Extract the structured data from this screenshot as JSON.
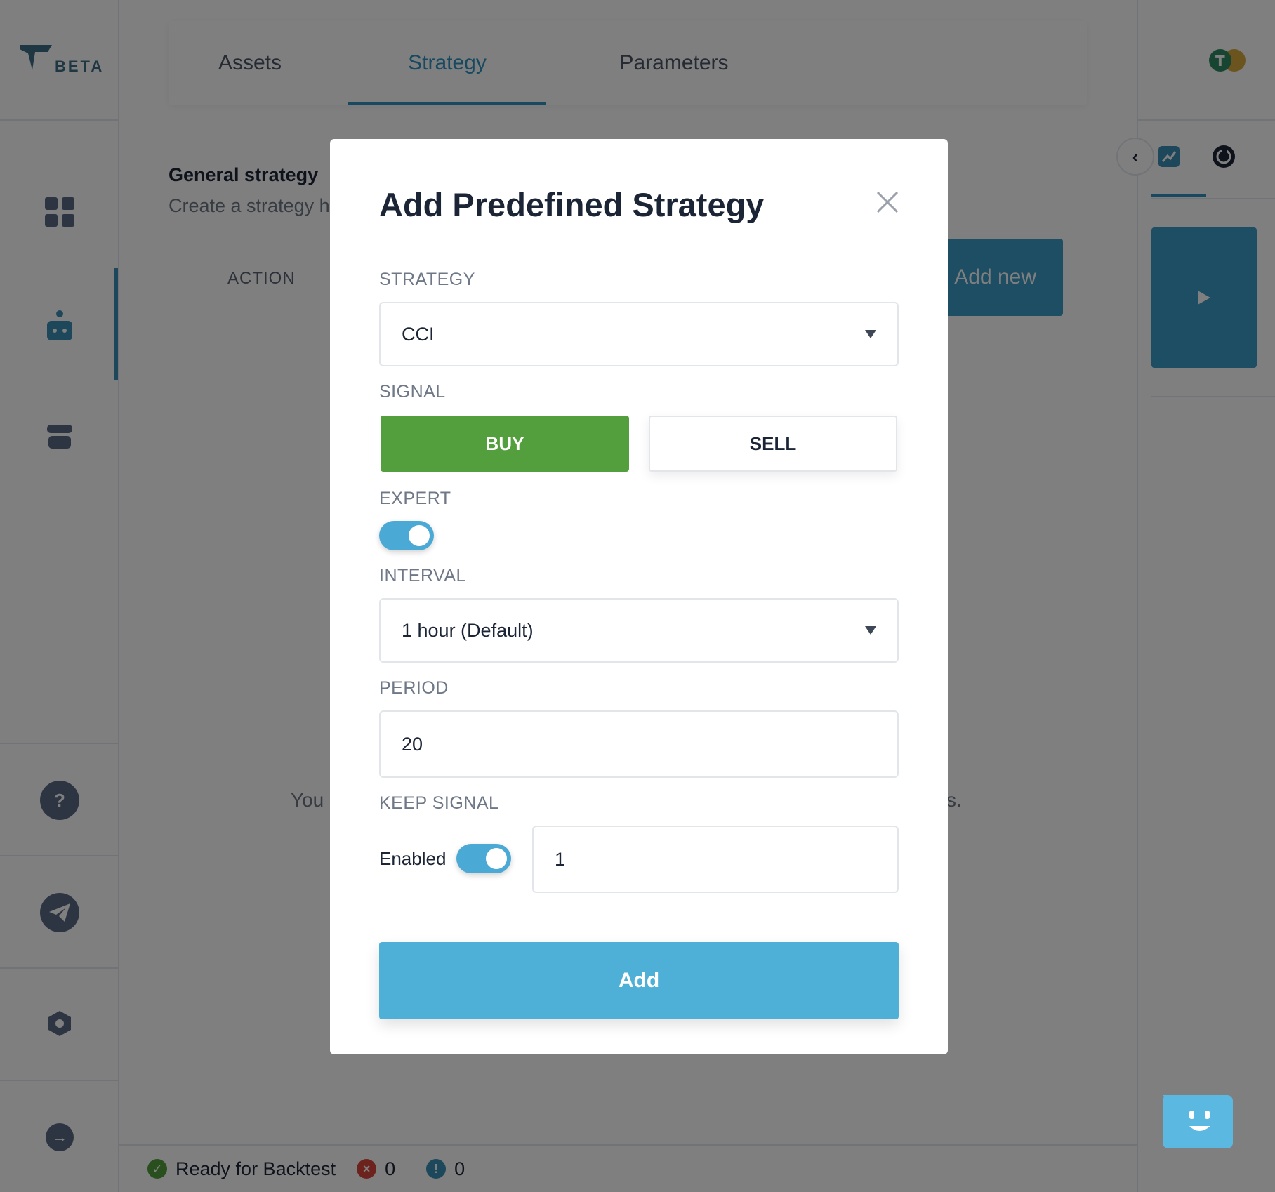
{
  "logo": {
    "badge": "BETA"
  },
  "tabs": [
    {
      "label": "Assets"
    },
    {
      "label": "Strategy"
    },
    {
      "label": "Parameters"
    }
  ],
  "background": {
    "general_title": "General strategy",
    "general_subtitle": "Create a strategy h",
    "column_action": "ACTION",
    "add_new_label": "Add new",
    "hint_left": "You",
    "hint_right": "s."
  },
  "sidebar": {
    "help_label": "?"
  },
  "statusbar": {
    "ready_text": "Ready for Backtest",
    "error_count": "0",
    "warning_count": "0"
  },
  "modal": {
    "title": "Add Predefined Strategy",
    "strategy_label": "STRATEGY",
    "strategy_value": "CCI",
    "signal_label": "SIGNAL",
    "buy_label": "BUY",
    "sell_label": "SELL",
    "selected_signal": "BUY",
    "expert_label": "EXPERT",
    "expert_on": true,
    "interval_label": "INTERVAL",
    "interval_value": "1 hour (Default)",
    "period_label": "PERIOD",
    "period_value": "20",
    "keep_signal_label": "KEEP SIGNAL",
    "enabled_label": "Enabled",
    "keep_signal_on": true,
    "keep_signal_value": "1",
    "add_label": "Add"
  },
  "colors": {
    "accent": "#2e93c2",
    "buy_green": "#539e3d",
    "add_button": "#4eb0d7",
    "toggle_on": "#4ba9d6"
  }
}
